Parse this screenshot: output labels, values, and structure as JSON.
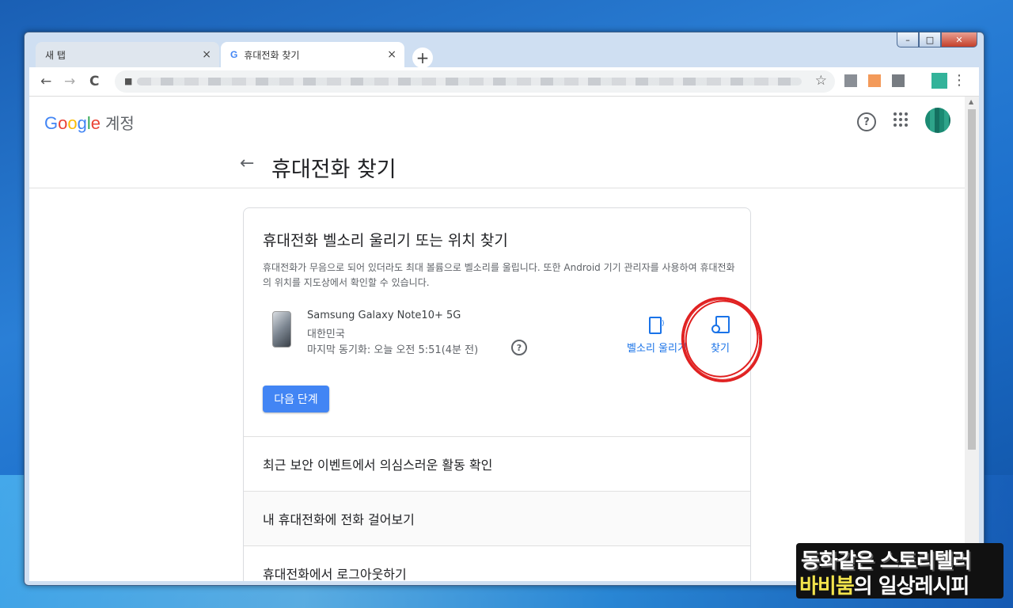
{
  "browser": {
    "tabs": [
      {
        "label": "새 탭",
        "close": "×"
      },
      {
        "label": "휴대전화 찾기",
        "close": "×"
      }
    ],
    "new_tab": "+",
    "nav": {
      "back": "←",
      "forward": "→",
      "reload": "C"
    },
    "star": "☆",
    "menu": "⋮",
    "window_controls": {
      "minimize": "–",
      "maximize": "□",
      "close": "✕"
    }
  },
  "header": {
    "logo_letters": [
      {
        "char": "G",
        "color": "#4285f4"
      },
      {
        "char": "o",
        "color": "#ea4335"
      },
      {
        "char": "o",
        "color": "#fbbc05"
      },
      {
        "char": "g",
        "color": "#4285f4"
      },
      {
        "char": "l",
        "color": "#34a853"
      },
      {
        "char": "e",
        "color": "#ea4335"
      }
    ],
    "account_label": "계정",
    "help": "?"
  },
  "page": {
    "back": "←",
    "title": "휴대전화 찾기"
  },
  "card": {
    "heading": "휴대전화 벨소리 울리기 또는 위치 찾기",
    "description": "휴대전화가 무음으로 되어 있더라도 최대 볼륨으로 벨소리를 울립니다. 또한 Android 기기 관리자를 사용하여 휴대전화의 위치를 지도상에서 확인할 수 있습니다.",
    "device": {
      "name": "Samsung Galaxy Note10+ 5G",
      "country": "대한민국",
      "last_sync": "마지막 동기화: 오늘 오전 5:51(4분 전)",
      "help": "?"
    },
    "actions": {
      "ring": "벨소리 울리기",
      "find": "찾기"
    },
    "next_button": "다음 단계",
    "rows": [
      "최근 보안 이벤트에서 의심스러운 활동 확인",
      "내 휴대전화에 전화 걸어보기",
      "휴대전화에서 로그아웃하기"
    ]
  },
  "watermark": {
    "line1": "동화같은 스토리텔러",
    "line2_highlight": "바비붐",
    "line2_rest": "의 일상레시피"
  },
  "colors": {
    "accent": "#1a73e8",
    "button": "#4285f4",
    "annotation": "#e02020"
  }
}
